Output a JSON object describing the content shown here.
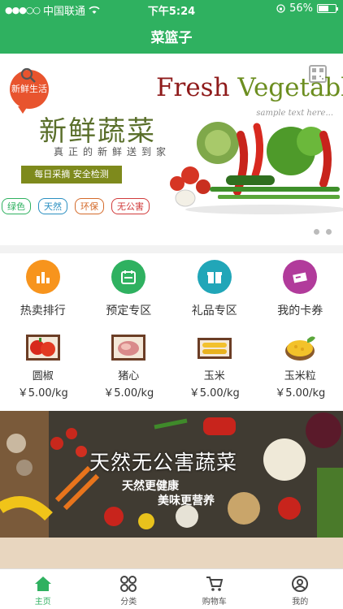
{
  "status_bar": {
    "carrier": "中国联通",
    "time": "下午5:24",
    "battery": "56%"
  },
  "header": {
    "title": "菜篮子"
  },
  "banner": {
    "bubble_text": "新鲜生活",
    "headline_en_1": "Fresh ",
    "headline_en_2": "Vegetables",
    "sample_text": "sample text here...",
    "headline_cn": "新鲜蔬菜",
    "subline_cn": "真正的新鲜送到家",
    "feature_box": "每日采摘 安全检测",
    "tags": [
      "绿色",
      "天然",
      "环保",
      "无公害"
    ],
    "page_count": 2
  },
  "categories": [
    {
      "label": "热卖排行",
      "icon": "bar-chart-icon",
      "color": "#f7941d"
    },
    {
      "label": "预定专区",
      "icon": "calendar-icon",
      "color": "#2fb160"
    },
    {
      "label": "礼品专区",
      "icon": "gift-box-icon",
      "color": "#21a6b8"
    },
    {
      "label": "我的卡券",
      "icon": "coupon-icon",
      "color": "#b13b9b"
    }
  ],
  "products": [
    {
      "name": "圆椒",
      "price": "￥5.00/kg"
    },
    {
      "name": "猪心",
      "price": "￥5.00/kg"
    },
    {
      "name": "玉米",
      "price": "￥5.00/kg"
    },
    {
      "name": "玉米粒",
      "price": "￥5.00/kg"
    }
  ],
  "promo": {
    "title": "天然无公害蔬菜",
    "subtitle_1": "天然更健康",
    "subtitle_2": "美味更营养"
  },
  "tabbar": {
    "items": [
      {
        "label": "主页",
        "icon": "home-icon",
        "active": true
      },
      {
        "label": "分类",
        "icon": "category-icon",
        "active": false
      },
      {
        "label": "购物车",
        "icon": "cart-icon",
        "active": false
      },
      {
        "label": "我的",
        "icon": "profile-icon",
        "active": false
      }
    ]
  },
  "colors": {
    "brand": "#2fb160"
  }
}
